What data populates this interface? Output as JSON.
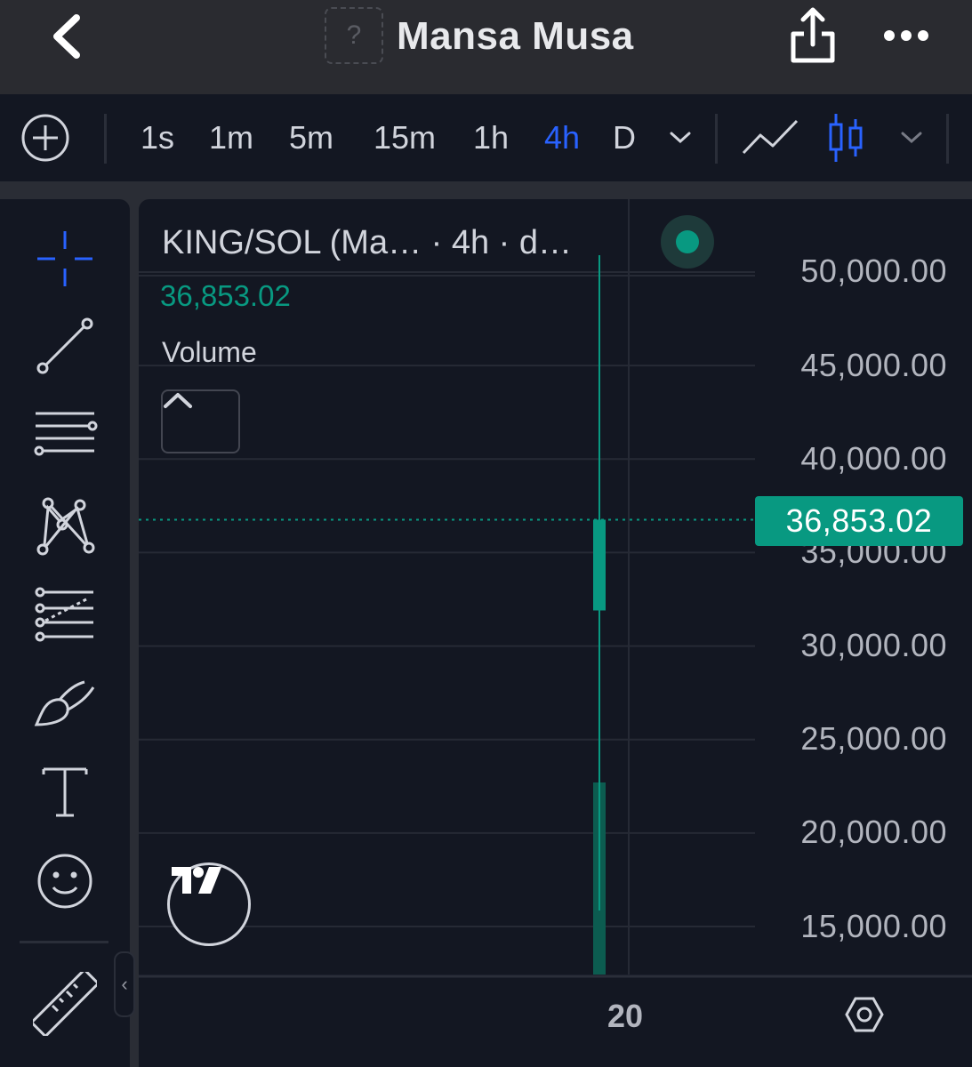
{
  "header": {
    "title": "Mansa Musa",
    "avatar_placeholder": "?"
  },
  "toolbar": {
    "intervals": [
      {
        "label": "1s",
        "active": false
      },
      {
        "label": "1m",
        "active": false
      },
      {
        "label": "5m",
        "active": false
      },
      {
        "label": "15m",
        "active": false
      },
      {
        "label": "1h",
        "active": false
      },
      {
        "label": "4h",
        "active": true
      },
      {
        "label": "D",
        "active": false
      }
    ],
    "chart_types": [
      "line-chart-icon",
      "candles-icon"
    ]
  },
  "drawing_tools": [
    "crosshair-icon",
    "trend-line-icon",
    "horizontal-lines-icon",
    "pattern-icon",
    "fib-icon",
    "brush-icon",
    "text-tool-icon",
    "emoji-icon",
    "ruler-icon"
  ],
  "legend": {
    "symbol": "KING/SOL (Ma…  · 4h · d…",
    "last_value": "36,853.02",
    "volume_label": "Volume"
  },
  "price_axis": {
    "labels": [
      "50,000.00",
      "45,000.00",
      "40,000.00",
      "35,000.00",
      "30,000.00",
      "25,000.00",
      "20,000.00",
      "15,000.00"
    ],
    "current_price_label": "36,853.02"
  },
  "time_axis": {
    "labels": [
      "20"
    ]
  },
  "colors": {
    "background": "#131722",
    "accent": "#2962ff",
    "up": "#089981",
    "text": "#d1d4dc"
  },
  "chart_data": {
    "type": "candlestick",
    "symbol": "KING/SOL",
    "interval": "4h",
    "ylim": [
      12500,
      52500
    ],
    "y_ticks": [
      50000,
      45000,
      40000,
      35000,
      30000,
      25000,
      20000,
      15000
    ],
    "last_price": 36853.02,
    "candles": [
      {
        "time": "20",
        "open": 32000,
        "high": 51000,
        "low": 10000,
        "close": 36853.02
      }
    ],
    "volume": [
      {
        "time": "20",
        "value": 1
      }
    ],
    "grid": true
  }
}
